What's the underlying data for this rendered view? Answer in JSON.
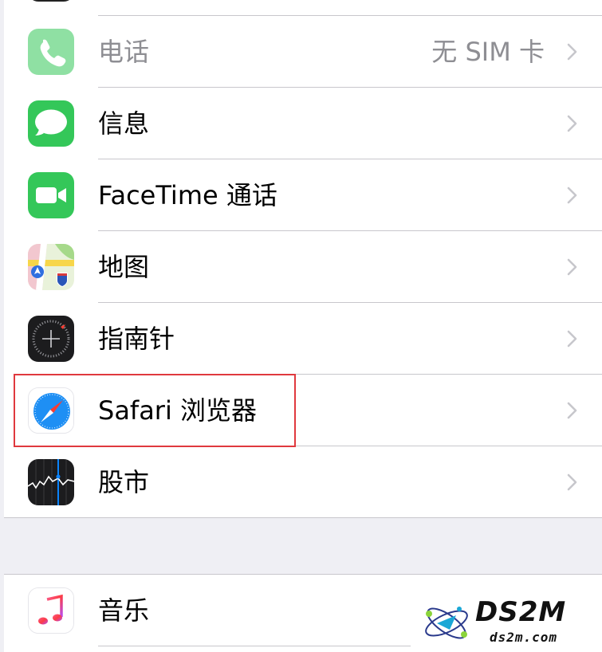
{
  "settings_list": {
    "group1": [
      {
        "id": "phone",
        "label": "电话",
        "value": "无 SIM 卡",
        "icon": "phone-icon",
        "color": "#34c759",
        "disabled": true
      },
      {
        "id": "messages",
        "label": "信息",
        "value": "",
        "icon": "messages-icon",
        "color": "#34c759"
      },
      {
        "id": "facetime",
        "label": "FaceTime 通话",
        "value": "",
        "icon": "facetime-icon",
        "color": "#34c759"
      },
      {
        "id": "maps",
        "label": "地图",
        "value": "",
        "icon": "maps-icon",
        "color": "#4fa3f7"
      },
      {
        "id": "compass",
        "label": "指南针",
        "value": "",
        "icon": "compass-icon",
        "color": "#1c1c1e"
      },
      {
        "id": "safari",
        "label": "Safari 浏览器",
        "value": "",
        "icon": "safari-icon",
        "color": "#1e8ff4",
        "highlighted": true
      },
      {
        "id": "stocks",
        "label": "股市",
        "value": "",
        "icon": "stocks-icon",
        "color": "#1c1c1e"
      }
    ],
    "group2": [
      {
        "id": "music",
        "label": "音乐",
        "value": "",
        "icon": "music-icon",
        "color": "#fc3c44"
      }
    ]
  },
  "chevron_icon": "chevron-right-icon",
  "highlight_color": "#e0393e",
  "watermark": {
    "brand": "DS2M",
    "domain": "ds2m.com"
  }
}
